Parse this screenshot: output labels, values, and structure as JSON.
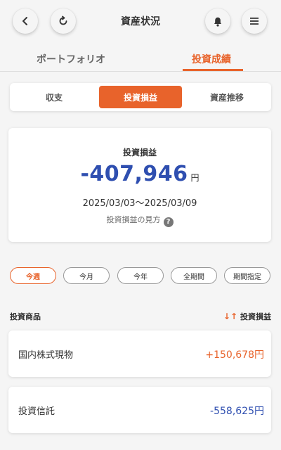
{
  "header": {
    "title": "資産状況",
    "icons": [
      "chevron-left-icon",
      "refresh-icon",
      "bell-icon",
      "menu-icon"
    ]
  },
  "tabs": [
    {
      "label": "ポートフォリオ",
      "active": false
    },
    {
      "label": "投資成績",
      "active": true
    }
  ],
  "segments": [
    {
      "label": "収支",
      "active": false
    },
    {
      "label": "投資損益",
      "active": true
    },
    {
      "label": "資産推移",
      "active": false
    }
  ],
  "summary": {
    "label": "投資損益",
    "amount": "-407,946",
    "unit": "円",
    "date_range": "2025/03/03〜2025/03/09",
    "help_text": "投資損益の見方",
    "help_icon": "?"
  },
  "periods": [
    {
      "label": "今週",
      "active": true
    },
    {
      "label": "今月",
      "active": false
    },
    {
      "label": "今年",
      "active": false
    },
    {
      "label": "全期間",
      "active": false
    },
    {
      "label": "期間指定",
      "active": false
    }
  ],
  "list": {
    "col_product": "投資商品",
    "col_pl": "投資損益",
    "sort_icon": "↓↑",
    "rows": [
      {
        "name": "国内株式現物",
        "value": "+150,678円",
        "color": "#e8632b"
      },
      {
        "name": "投資信託",
        "value": "-558,625円",
        "color": "#2f4fb0"
      }
    ]
  },
  "colors": {
    "accent": "#e8632b",
    "negative": "#2f4fb0",
    "background": "#f5f5f5"
  }
}
